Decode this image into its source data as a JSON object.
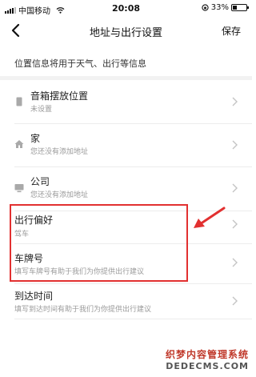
{
  "status_bar": {
    "carrier": "中国移动",
    "time": "20:08",
    "battery_percent": "33%",
    "battery_level": 0.33
  },
  "nav": {
    "title": "地址与出行设置",
    "save_label": "保存"
  },
  "page_note": "位置信息将用于天气、出行等信息",
  "rows": [
    {
      "title": "音箱摆放位置",
      "subtitle": "未设置",
      "icon": "speaker-icon"
    },
    {
      "title": "家",
      "subtitle": "您还没有添加地址",
      "icon": "home-icon"
    },
    {
      "title": "公司",
      "subtitle": "您还没有添加地址",
      "icon": "office-icon"
    },
    {
      "title": "出行偏好",
      "subtitle": "驾车",
      "icon": null
    },
    {
      "title": "车牌号",
      "subtitle": "填写车牌号有助于我们为你提供出行建议",
      "icon": null
    },
    {
      "title": "到达时间",
      "subtitle": "填写到达时间有助于我们为你提供出行建议",
      "icon": null
    }
  ],
  "colors": {
    "highlight": "#e23030",
    "watermark": "#c0392b"
  },
  "watermark": {
    "top": "织梦内容管理系统",
    "bottom": "DEDECMS.COM"
  }
}
